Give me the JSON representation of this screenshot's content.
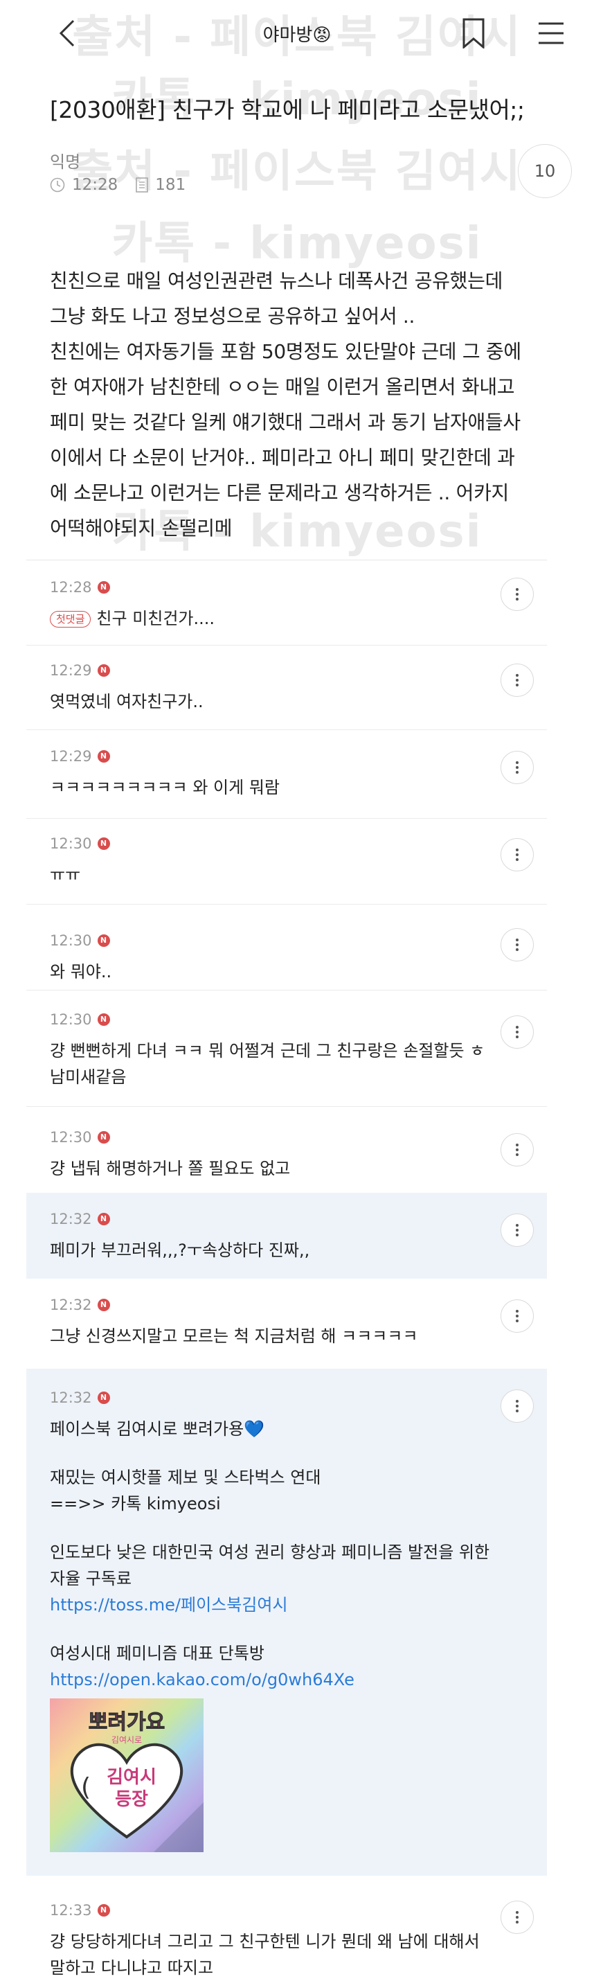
{
  "colors": {
    "accent": "#d94c4c",
    "link": "#2a7bd6",
    "highlight": "#eef3fa",
    "watermark": "#e9e9e9"
  },
  "header": {
    "back_icon": "back-arrow-icon",
    "title": "야마방😡",
    "bookmark_icon": "bookmark-icon",
    "menu_icon": "hamburger-menu-icon"
  },
  "watermark": {
    "lines": [
      "출처 - 페이스북 김여시",
      "카톡 - kimyeosi",
      "출처 - 페이스북 김여시",
      "카톡 - kimyeosi",
      "카톡 - kimyeosi"
    ]
  },
  "post": {
    "title": "[2030애환] 친구가 학교에 나 페미라고 소문냈어;;",
    "author": "익명",
    "time": "12:28",
    "views": "181",
    "comment_count": "10",
    "body": "친친으로 매일 여성인권관련 뉴스나 데폭사건 공유했는데\n그냥 화도 나고 정보성으로 공유하고 싶어서 ..\n친친에는 여자동기들 포함 50명정도 있단말야 근데 그 중에\n한 여자애가 남친한테 ㅇㅇ는 매일 이런거 올리면서 화내고\n페미 맞는 것같다 일케 얘기했대 그래서 과 동기 남자애들사\n이에서 다 소문이 난거야.. 페미라고 아니 페미 맞긴한데 과\n에 소문나고 이런거는 다른 문제라고 생각하거든 .. 어카지\n어떡해야되지 손떨리메"
  },
  "comments": [
    {
      "time": "12:28",
      "badge": "첫댓글",
      "text": "친구 미친건가...."
    },
    {
      "time": "12:29",
      "text": "엿먹였네 여자친구가.."
    },
    {
      "time": "12:29",
      "text": "ㅋㅋㅋㅋㅋㅋㅋㅋㅋ 와 이게 뭐람"
    },
    {
      "time": "12:30",
      "text": "ㅠㅠ"
    },
    {
      "time": "12:30",
      "text": "와 뭐야.."
    },
    {
      "time": "12:30",
      "text": "걍 뻔뻔하게 다녀 ㅋㅋ 뭐 어쩔겨 근데 그 친구랑은 손절할듯 ㅎ\n남미새같음"
    },
    {
      "time": "12:30",
      "text": "걍 냅둬 해명하거나 쫄 필요도 없고"
    },
    {
      "time": "12:32",
      "text": "페미가 부끄러워,,,?ㅜ속상하다 진짜,,"
    },
    {
      "time": "12:32",
      "text": "그냥 신경쓰지말고 모르는 척 지금처럼 해 ㅋㅋㅋㅋㅋ"
    },
    {
      "time": "12:32",
      "promo": {
        "line1": "페이스북 김여시로 뽀려가용",
        "line1_emoji": "💙",
        "line2": "재밌는 여시핫플 제보 및 스타벅스 연대",
        "line3": "==>> 카톡 kimyeosi",
        "line4": "인도보다 낮은 대한민국 여성 권리 향상과 페미니즘 발전을 위한\n자율 구독료",
        "link1": "https://toss.me/페이스북김여시",
        "line5": "여성시대 페미니즘 대표 단톡방",
        "link2": "https://open.kakao.com/o/g0wh64Xe",
        "sticker_top": "뽀려가요",
        "sticker_sub": "김여시로",
        "sticker_main1": "김여시",
        "sticker_main2": "등장"
      }
    },
    {
      "time": "12:33",
      "text": "걍 당당하게다녀 그리고 그 친구한텐 니가 뭔데 왜 남에 대해서\n말하고 다니냐고 따지고"
    }
  ]
}
